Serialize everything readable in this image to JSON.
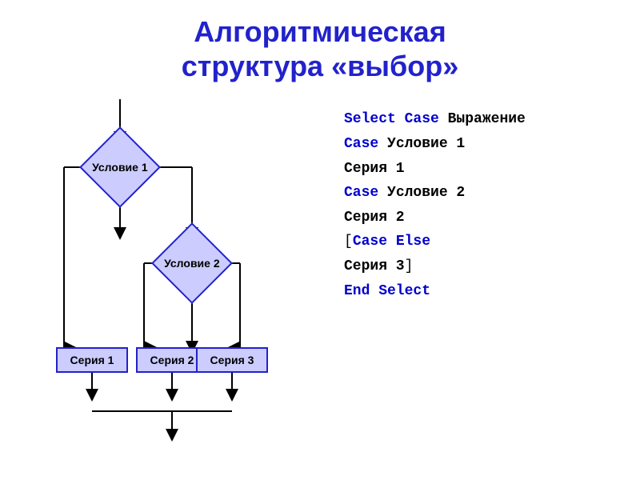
{
  "title": {
    "line1": "Алгоритмическая",
    "line2": "структура «выбор»"
  },
  "diagram": {
    "diamond1": "Условие 1",
    "diamond2": "Условие 2",
    "rect1": "Серия 1",
    "rect2": "Серия 2",
    "rect3": "Серия 3"
  },
  "code": {
    "line1_kw": "Select Case",
    "line1_rest": " Выражение",
    "line2_kw": "Case",
    "line2_rest": " Условие 1",
    "line3": "    Серия 1",
    "line4_kw": "Case",
    "line4_rest": " Условие 2",
    "line5": "    Серия 2",
    "line6_bracket": "[",
    "line6_kw": "Case Else",
    "line7": "    Серия 3",
    "line7_bracket": "]",
    "line8_kw": "End Select"
  }
}
